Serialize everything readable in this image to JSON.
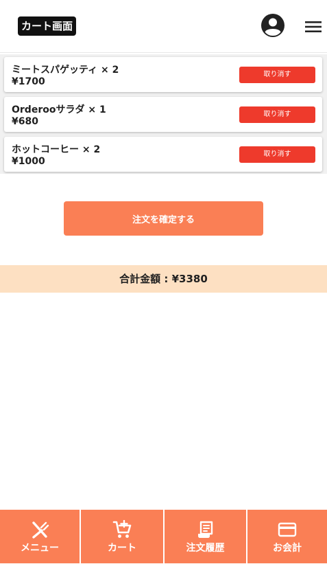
{
  "header": {
    "title": "カート画面",
    "account_icon": "account-circle-icon",
    "menu_icon": "hamburger-menu-icon"
  },
  "cart": {
    "items": [
      {
        "name": "ミートスパゲッティ × 2",
        "price": "¥1700",
        "cancel_label": "取り消す"
      },
      {
        "name": "Orderooサラダ × 1",
        "price": "¥680",
        "cancel_label": "取り消す"
      },
      {
        "name": "ホットコーヒー × 2",
        "price": "¥1000",
        "cancel_label": "取り消す"
      }
    ]
  },
  "confirm_label": "注文を確定する",
  "total_label": "合計金額 : ¥3380",
  "bottom_nav": {
    "items": [
      {
        "label": "メニュー",
        "icon": "fork-knife-icon"
      },
      {
        "label": "カート",
        "icon": "cart-icon"
      },
      {
        "label": "注文履歴",
        "icon": "receipt-icon"
      },
      {
        "label": "お会計",
        "icon": "credit-card-icon"
      }
    ]
  },
  "colors": {
    "accent": "#fa7f55",
    "cancel": "#ee3a2c",
    "total_bg": "#fde0c2",
    "title_bg": "#111111"
  }
}
